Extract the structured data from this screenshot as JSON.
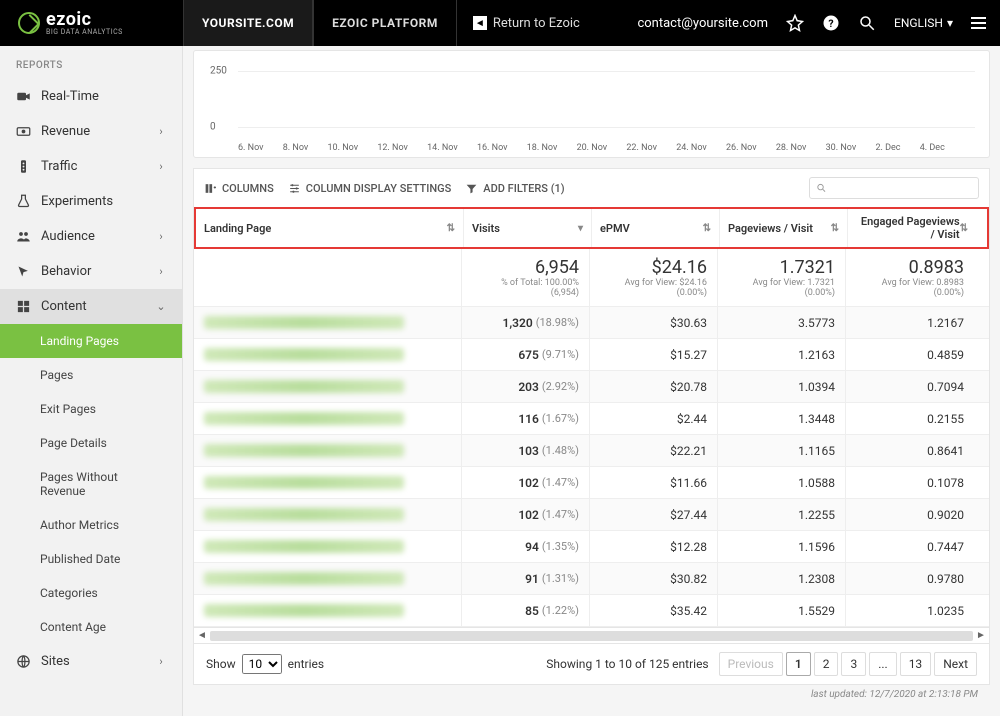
{
  "brand": {
    "name": "ezoic",
    "tagline": "BIG DATA ANALYTICS"
  },
  "topbar": {
    "tabs": [
      "YOURSITE.COM",
      "EZOIC PLATFORM"
    ],
    "return_label": "Return to Ezoic",
    "contact": "contact@yoursite.com",
    "language": "ENGLISH"
  },
  "sidebar": {
    "section": "REPORTS",
    "items": [
      {
        "label": "Real-Time",
        "expandable": false
      },
      {
        "label": "Revenue",
        "expandable": true
      },
      {
        "label": "Traffic",
        "expandable": true
      },
      {
        "label": "Experiments",
        "expandable": false
      },
      {
        "label": "Audience",
        "expandable": true
      },
      {
        "label": "Behavior",
        "expandable": true
      },
      {
        "label": "Content",
        "expandable": true,
        "open": true
      },
      {
        "label": "Sites",
        "expandable": true
      }
    ],
    "content_sub": [
      "Landing Pages",
      "Pages",
      "Exit Pages",
      "Page Details",
      "Pages Without Revenue",
      "Author Metrics",
      "Published Date",
      "Categories",
      "Content Age"
    ]
  },
  "chart_data": {
    "type": "line",
    "title": "",
    "xlabel": "",
    "ylabel": "",
    "ylim": [
      0,
      250
    ],
    "y_ticks": [
      "250",
      "0"
    ],
    "x_ticks": [
      "6. Nov",
      "8. Nov",
      "10. Nov",
      "12. Nov",
      "14. Nov",
      "16. Nov",
      "18. Nov",
      "20. Nov",
      "22. Nov",
      "24. Nov",
      "26. Nov",
      "28. Nov",
      "30. Nov",
      "2. Dec",
      "4. Dec"
    ]
  },
  "toolbar": {
    "columns": "COLUMNS",
    "display_settings": "COLUMN DISPLAY SETTINGS",
    "add_filters": "ADD FILTERS (1)"
  },
  "table": {
    "headers": [
      "Landing Page",
      "Visits",
      "ePMV",
      "Pageviews / Visit",
      "Engaged Pageviews / Visit"
    ],
    "summary": {
      "visits": {
        "value": "6,954",
        "sub": "% of Total: 100.00% (6,954)"
      },
      "epmv": {
        "value": "$24.16",
        "sub": "Avg for View: $24.16 (0.00%)"
      },
      "ppv": {
        "value": "1.7321",
        "sub": "Avg for View: 1.7321 (0.00%)"
      },
      "eppv": {
        "value": "0.8983",
        "sub": "Avg for View: 0.8983 (0.00%)"
      }
    },
    "rows": [
      {
        "visits": "1,320",
        "visits_pct": "(18.98%)",
        "epmv": "$30.63",
        "ppv": "3.5773",
        "eppv": "1.2167"
      },
      {
        "visits": "675",
        "visits_pct": "(9.71%)",
        "epmv": "$15.27",
        "ppv": "1.2163",
        "eppv": "0.4859"
      },
      {
        "visits": "203",
        "visits_pct": "(2.92%)",
        "epmv": "$20.78",
        "ppv": "1.0394",
        "eppv": "0.7094"
      },
      {
        "visits": "116",
        "visits_pct": "(1.67%)",
        "epmv": "$2.44",
        "ppv": "1.3448",
        "eppv": "0.2155"
      },
      {
        "visits": "103",
        "visits_pct": "(1.48%)",
        "epmv": "$22.21",
        "ppv": "1.1165",
        "eppv": "0.8641"
      },
      {
        "visits": "102",
        "visits_pct": "(1.47%)",
        "epmv": "$11.66",
        "ppv": "1.0588",
        "eppv": "0.1078"
      },
      {
        "visits": "102",
        "visits_pct": "(1.47%)",
        "epmv": "$27.44",
        "ppv": "1.2255",
        "eppv": "0.9020"
      },
      {
        "visits": "94",
        "visits_pct": "(1.35%)",
        "epmv": "$12.28",
        "ppv": "1.1596",
        "eppv": "0.7447"
      },
      {
        "visits": "91",
        "visits_pct": "(1.31%)",
        "epmv": "$30.82",
        "ppv": "1.2308",
        "eppv": "0.9780"
      },
      {
        "visits": "85",
        "visits_pct": "(1.22%)",
        "epmv": "$35.42",
        "ppv": "1.5529",
        "eppv": "1.0235"
      }
    ]
  },
  "footer": {
    "show_label": "Show",
    "entries_label": "entries",
    "page_size": "10",
    "paging_info": "Showing 1 to 10 of 125 entries",
    "pages": [
      "Previous",
      "1",
      "2",
      "3",
      "...",
      "13",
      "Next"
    ],
    "last_updated": "last updated: 12/7/2020 at 2:13:18 PM"
  }
}
